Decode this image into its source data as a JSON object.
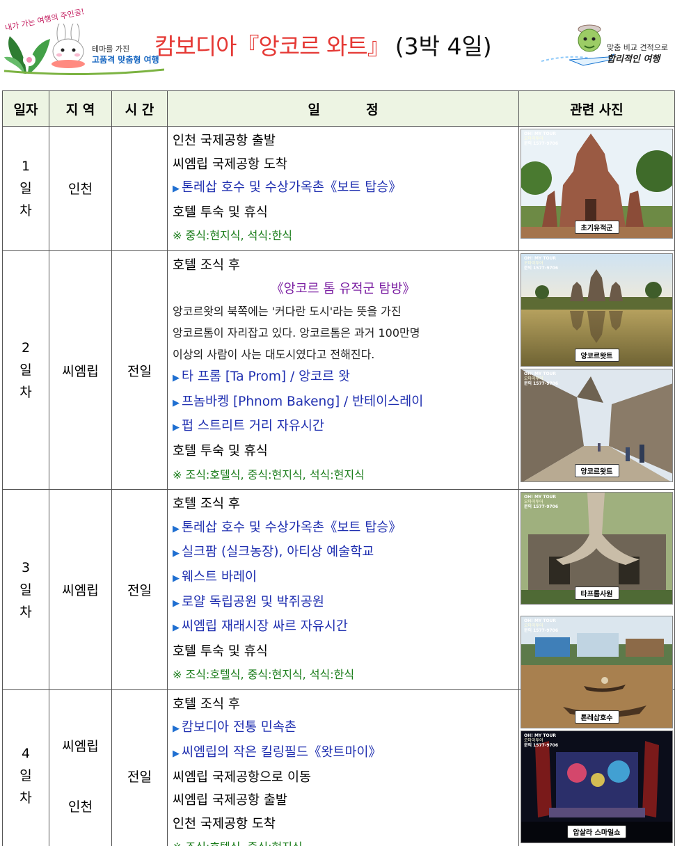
{
  "header": {
    "left_logo_scribble": "내가 가는 여행의 주인공!",
    "left_logo_line1": "테마를 가진",
    "left_logo_line2": "고품격 맞춤형 여행",
    "title_main": "캄보디아『앙코르 와트』",
    "title_duration": "(3박 4일)",
    "right_logo_line1": "맞춤 비교 견적으로",
    "right_logo_line2": "합리적인 여행"
  },
  "table": {
    "headers": {
      "day": "일자",
      "area": "지 역",
      "time": "시 간",
      "schedule": "일          정",
      "photos": "관련 사진"
    },
    "days": [
      {
        "day_num": "1",
        "day_il": "일",
        "day_cha": "차",
        "area": "인천",
        "time": "",
        "lines": [
          {
            "text": "인천 국제공항 출발"
          },
          {
            "text": "씨엠립 국제공항 도착"
          },
          {
            "text": "톤레삽 호수 및 수상가옥촌《보트 탑승》"
          },
          {
            "text": "호텔 투숙 및 휴식"
          },
          {
            "text": "※ 중식:현지식, 석식:한식"
          }
        ]
      },
      {
        "day_num": "2",
        "day_il": "일",
        "day_cha": "차",
        "area": "씨엠립",
        "time": "전일",
        "lines": [
          {
            "text": "호텔 조식 후"
          },
          {
            "text": "《앙코르 톰 유적군 탐방》"
          },
          {
            "text": "앙코르왓의 북쪽에는 '커다란 도시'라는 뜻을 가진"
          },
          {
            "text": "앙코르톰이 자리잡고 있다. 앙코르톰은 과거 100만명"
          },
          {
            "text": "이상의 사람이 사는 대도시였다고 전해진다."
          },
          {
            "text": "타 프롬 [Ta Prom] / 앙코르 왓"
          },
          {
            "text": "프놈바켕 [Phnom Bakeng] / 반테이스레이"
          },
          {
            "text": "펍 스트리트 거리 자유시간"
          },
          {
            "text": "호텔 투숙 및 휴식"
          },
          {
            "text": "※ 조식:호텔식, 중식:현지식, 석식:현지식"
          }
        ]
      },
      {
        "day_num": "3",
        "day_il": "일",
        "day_cha": "차",
        "area": "씨엠립",
        "time": "전일",
        "lines": [
          {
            "text": "호텔 조식 후"
          },
          {
            "text": "톤레삽 호수 및 수상가옥촌《보트 탑승》"
          },
          {
            "text": "실크팜 (실크농장), 아티상 예술학교"
          },
          {
            "text": "웨스트 바레이"
          },
          {
            "text": "로얄 독립공원 및 박쥐공원"
          },
          {
            "text": "씨엠립 재래시장 싸르 자유시간"
          },
          {
            "text": "호텔 투숙 및 휴식"
          },
          {
            "text": "※ 조식:호텔식, 중식:현지식, 석식:한식"
          }
        ]
      },
      {
        "day_num": "4",
        "day_il": "일",
        "day_cha": "차",
        "area": "씨엠립",
        "area2": "인천",
        "time": "전일",
        "lines": [
          {
            "text": "호텔 조식 후"
          },
          {
            "text": "캄보디아 전통 민속촌"
          },
          {
            "text": "씨엠립의 작은 킬링필드《왓트마이》"
          },
          {
            "text": "씨엠립 국제공항으로 이동"
          },
          {
            "text": "씨엠립 국제공항 출발"
          },
          {
            "text": "인천 국제공항 도착"
          },
          {
            "text": "※ 조식:호텔식, 중식:현지식"
          }
        ]
      }
    ],
    "photos": [
      {
        "caption": "초기유적군",
        "icon": "temple-photo"
      },
      {
        "caption": "앙코르왓트",
        "icon": "angkor-reflection-photo"
      },
      {
        "caption": "앙코르왓트",
        "icon": "corridor-photo"
      },
      {
        "caption": "타프롬사원",
        "icon": "tree-ruins-photo"
      },
      {
        "caption": "톤레삽호수",
        "icon": "floating-village-photo"
      },
      {
        "caption": "압살라 스마일쇼",
        "icon": "stage-show-photo"
      }
    ],
    "watermark": {
      "brand": "OH! MY TOUR",
      "sub": "오마이투어",
      "phone": "문의 1577-9706"
    }
  },
  "colors": {
    "title_red": "#e53935",
    "schedule_blue": "#1f2fb0",
    "meal_green": "#1b7d1b",
    "highlight_purple": "#7b1fa2",
    "header_bg": "#edf4e3"
  }
}
